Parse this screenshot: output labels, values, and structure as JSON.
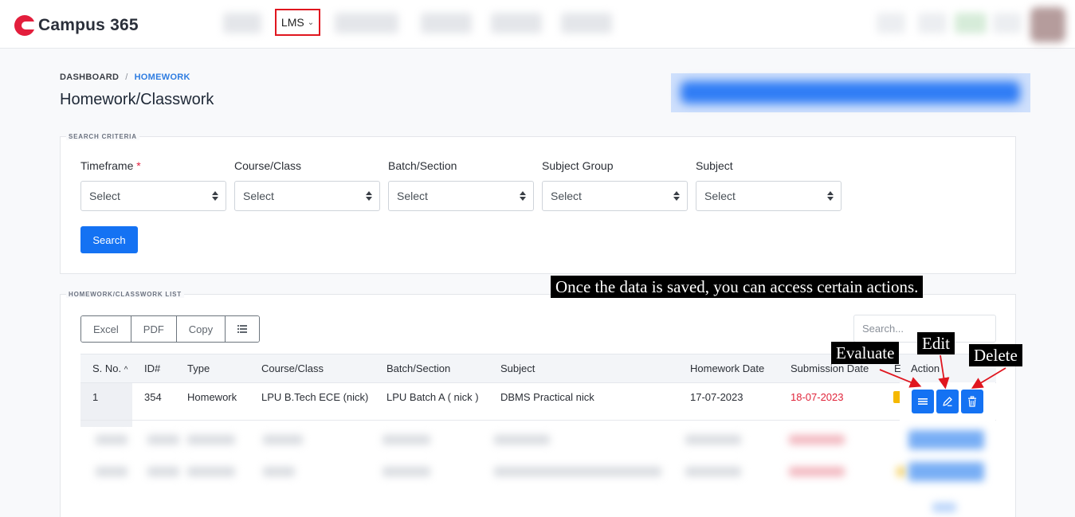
{
  "brand": {
    "name": "Campus 365"
  },
  "nav": {
    "lms_label": "LMS"
  },
  "breadcrumb": {
    "root": "DASHBOARD",
    "separator": "/",
    "current": "HOMEWORK"
  },
  "page": {
    "title": "Homework/Classwork"
  },
  "search_criteria": {
    "legend": "SEARCH CRITERIA",
    "required_mark": "*",
    "fields": [
      {
        "label": "Timeframe",
        "value": "Select",
        "required": true
      },
      {
        "label": "Course/Class",
        "value": "Select"
      },
      {
        "label": "Batch/Section",
        "value": "Select"
      },
      {
        "label": "Subject Group",
        "value": "Select"
      },
      {
        "label": "Subject",
        "value": "Select"
      }
    ],
    "search_button": "Search"
  },
  "list": {
    "legend": "HOMEWORK/CLASSWORK LIST",
    "export_buttons": [
      "Excel",
      "PDF",
      "Copy"
    ],
    "search_placeholder": "Search...",
    "columns": [
      "S. No.",
      "ID#",
      "Type",
      "Course/Class",
      "Batch/Section",
      "Subject",
      "Homework Date",
      "Submission Date",
      "E",
      "Action"
    ],
    "sort_indicator": "^",
    "rows": [
      {
        "sno": "1",
        "id": "354",
        "type": "Homework",
        "course": "LPU B.Tech ECE (nick)",
        "batch": "LPU Batch A ( nick )",
        "subject": "DBMS Practical nick",
        "homework_date": "17-07-2023",
        "submission_date": "18-07-2023"
      }
    ]
  },
  "annotations": {
    "message": "Once the data is saved, you can access certain actions.",
    "evaluate": "Evaluate",
    "edit": "Edit",
    "delete": "Delete"
  },
  "colors": {
    "primary": "#1472f3",
    "brand_red": "#e31e3c",
    "late_date": "#e0243a",
    "highlight_border": "#e0161f"
  },
  "icons": [
    "brand-logo-icon",
    "chevron-down-icon",
    "sort-up-icon",
    "column-list-icon",
    "evaluate-list-icon",
    "edit-pencil-icon",
    "delete-trash-icon"
  ]
}
